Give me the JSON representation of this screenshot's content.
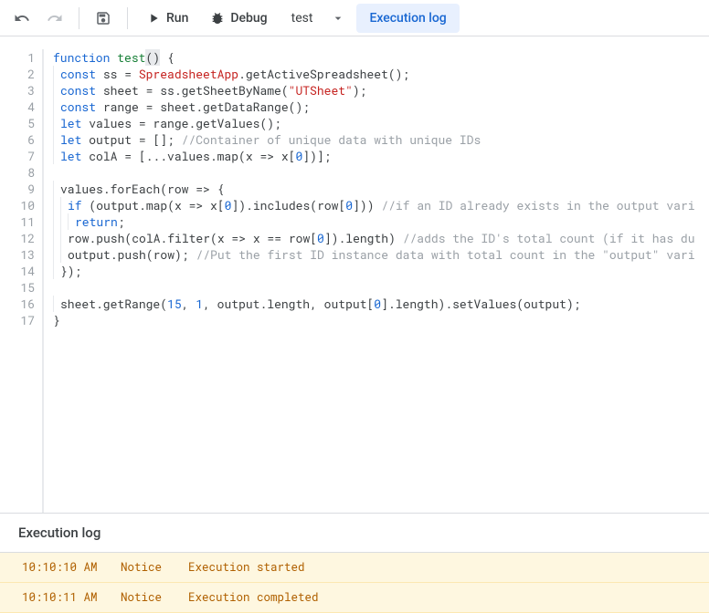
{
  "toolbar": {
    "run_label": "Run",
    "debug_label": "Debug",
    "function_name": "test",
    "exec_log_label": "Execution log"
  },
  "code": {
    "lines": [
      {
        "n": 1,
        "indent": 0,
        "html": "<span class='tok-kw'>function</span> <span class='tok-type'>test</span><span class='cursor-hl'>()</span> {"
      },
      {
        "n": 2,
        "indent": 1,
        "html": "<span class='tok-kw'>const</span> ss = <span class='tok-obj'>SpreadsheetApp</span>.getActiveSpreadsheet();"
      },
      {
        "n": 3,
        "indent": 1,
        "html": "<span class='tok-kw'>const</span> sheet = ss.getSheetByName(<span class='tok-str'>\"UTSheet\"</span>);"
      },
      {
        "n": 4,
        "indent": 1,
        "html": "<span class='tok-kw'>const</span> range = sheet.getDataRange();"
      },
      {
        "n": 5,
        "indent": 1,
        "html": "<span class='tok-kw'>let</span> values = range.getValues();"
      },
      {
        "n": 6,
        "indent": 1,
        "html": "<span class='tok-kw'>let</span> output = []; <span class='tok-cmt'>//Container of unique data with unique IDs</span>"
      },
      {
        "n": 7,
        "indent": 1,
        "html": "<span class='tok-kw'>let</span> colA = [...values.map(x =&gt; x[<span class='tok-num'>0</span>])];"
      },
      {
        "n": 8,
        "indent": 0,
        "html": ""
      },
      {
        "n": 9,
        "indent": 1,
        "html": "values.forEach(row =&gt; {"
      },
      {
        "n": 10,
        "indent": 2,
        "html": "<span class='tok-kw'>if</span> (output.map(x =&gt; x[<span class='tok-num'>0</span>]).includes(row[<span class='tok-num'>0</span>])) <span class='tok-cmt'>//if an ID already exists in the output vari</span>"
      },
      {
        "n": 11,
        "indent": 3,
        "html": "<span class='tok-kw'>return</span>;"
      },
      {
        "n": 12,
        "indent": 2,
        "html": "row.push(colA.filter(x =&gt; x == row[<span class='tok-num'>0</span>]).length) <span class='tok-cmt'>//adds the ID's total count (if it has du</span>"
      },
      {
        "n": 13,
        "indent": 2,
        "html": "output.push(row); <span class='tok-cmt'>//Put the first ID instance data with total count in the \"output\" vari</span>"
      },
      {
        "n": 14,
        "indent": 1,
        "html": "});"
      },
      {
        "n": 15,
        "indent": 0,
        "html": ""
      },
      {
        "n": 16,
        "indent": 1,
        "html": "sheet.getRange(<span class='tok-num'>15</span>, <span class='tok-num'>1</span>, output.length, output[<span class='tok-num'>0</span>].length).setValues(output);"
      },
      {
        "n": 17,
        "indent": 0,
        "html": "}"
      }
    ]
  },
  "log": {
    "title": "Execution log",
    "rows": [
      {
        "time": "10:10:10 AM",
        "level": "Notice",
        "msg": "Execution started"
      },
      {
        "time": "10:10:11 AM",
        "level": "Notice",
        "msg": "Execution completed"
      }
    ]
  }
}
